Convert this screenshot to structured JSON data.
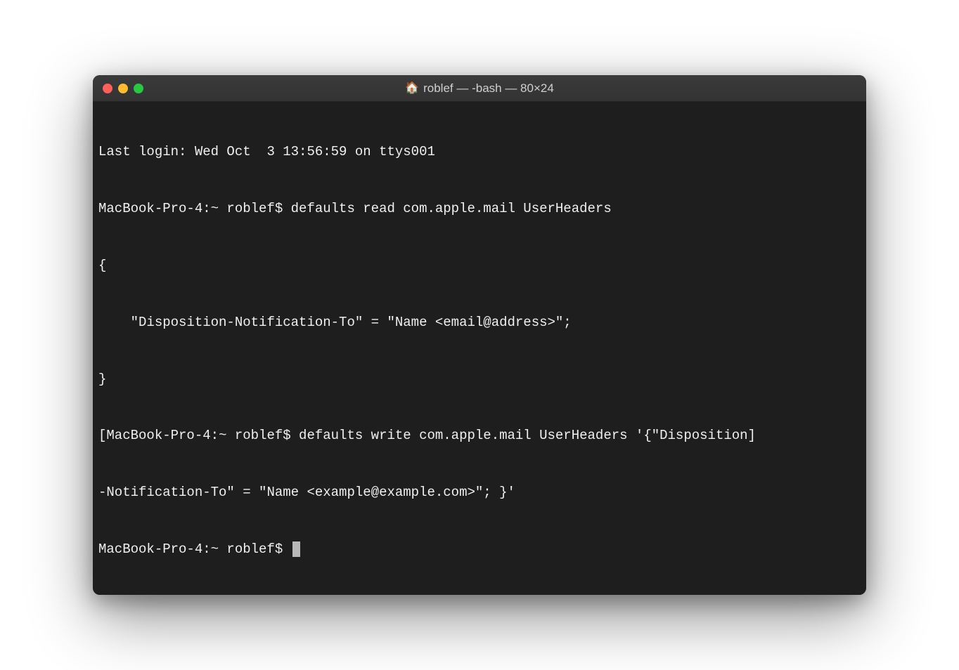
{
  "window": {
    "title": "roblef — -bash — 80×24",
    "home_icon": "🏠"
  },
  "terminal": {
    "lines": [
      "Last login: Wed Oct  3 13:56:59 on ttys001",
      "MacBook-Pro-4:~ roblef$ defaults read com.apple.mail UserHeaders",
      "{",
      "    \"Disposition-Notification-To\" = \"Name <email@address>\";",
      "}",
      "[MacBook-Pro-4:~ roblef$ defaults write com.apple.mail UserHeaders '{\"Disposition]",
      "-Notification-To\" = \"Name <example@example.com>\"; }'",
      "MacBook-Pro-4:~ roblef$ "
    ]
  },
  "colors": {
    "window_bg": "#1e1e1e",
    "titlebar_bg": "#363636",
    "text": "#f0f0f0",
    "close": "#ff5f57",
    "minimize": "#febc2e",
    "maximize": "#28c840"
  }
}
